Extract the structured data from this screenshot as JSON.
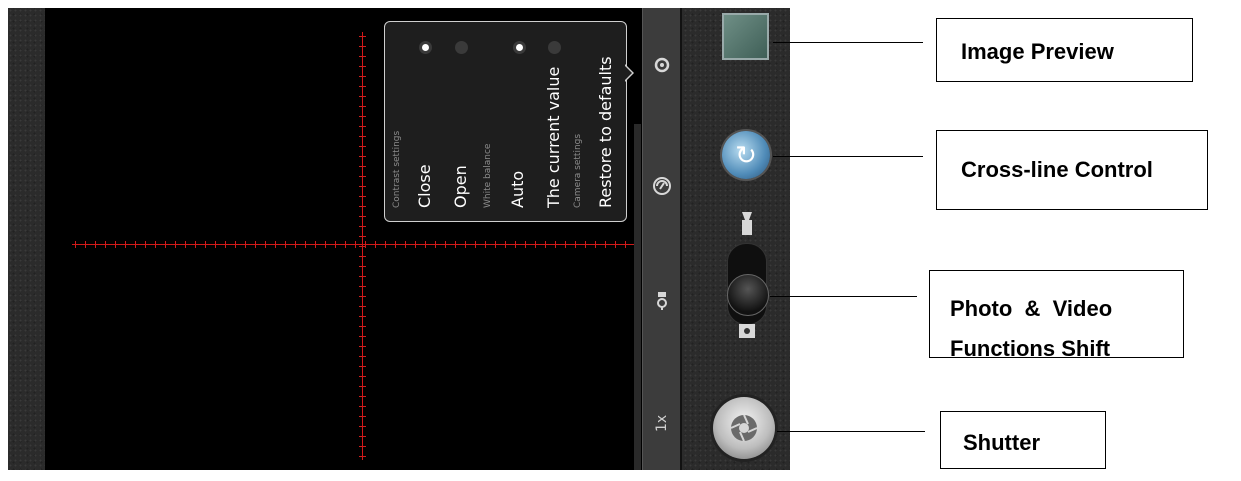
{
  "menu": {
    "sections": [
      {
        "header": "Contrast settings",
        "options": [
          {
            "label": "Close",
            "selected": true
          },
          {
            "label": "Open",
            "selected": false
          }
        ]
      },
      {
        "header": "White balance",
        "options": [
          {
            "label": "Auto",
            "selected": true
          },
          {
            "label": "The current value",
            "selected": false
          }
        ]
      },
      {
        "header": "Camera settings",
        "options": [
          {
            "label": "Restore to defaults"
          }
        ]
      }
    ]
  },
  "sidebar": {
    "zoom_label": "1x",
    "icons": [
      "settings-icon",
      "color-effect-icon",
      "white-balance-icon"
    ]
  },
  "controls": {
    "preview_icon": "image-thumbnail",
    "crossline_icon": "rotate-icon",
    "mode_switch": {
      "top_icon": "video-camera-icon",
      "bottom_icon": "camera-icon",
      "mode": "photo"
    },
    "shutter_icon": "aperture-icon"
  },
  "callouts": {
    "image_preview": "Image Preview",
    "crossline": "Cross-line Control",
    "mode_shift_line1": "Photo  &  Video",
    "mode_shift_line2": "Functions Shift",
    "shutter": "Shutter"
  },
  "colors": {
    "crosshair": "#d11a1a",
    "viewfinder": "#000000",
    "menu_bg": "#1e1e1e"
  }
}
